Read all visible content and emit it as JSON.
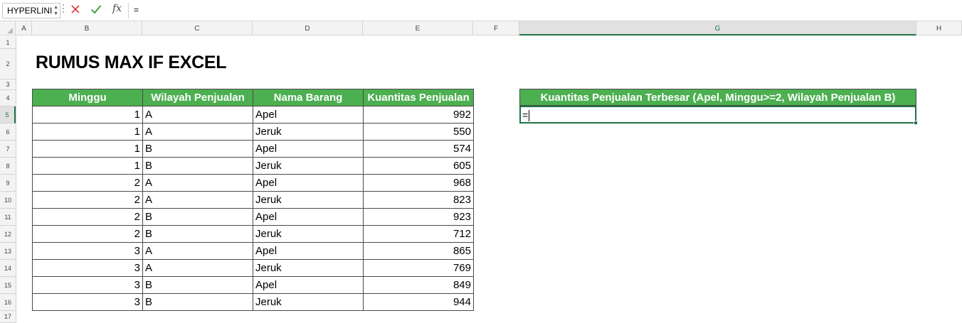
{
  "formula_bar": {
    "name_box": "HYPERLINI",
    "fx_label": "fx",
    "formula": "="
  },
  "columns": [
    "A",
    "B",
    "C",
    "D",
    "E",
    "F",
    "G",
    "H"
  ],
  "rows": [
    "1",
    "2",
    "3",
    "4",
    "5",
    "6",
    "7",
    "8",
    "9",
    "10",
    "11",
    "12",
    "13",
    "14",
    "15",
    "16",
    "17"
  ],
  "selected": {
    "column": "G",
    "row": "5"
  },
  "title": "RUMUS MAX IF EXCEL",
  "table": {
    "headers": [
      "Minggu",
      "Wilayah Penjualan",
      "Nama Barang",
      "Kuantitas Penjualan"
    ],
    "rows": [
      [
        "1",
        "A",
        "Apel",
        "992"
      ],
      [
        "1",
        "A",
        "Jeruk",
        "550"
      ],
      [
        "1",
        "B",
        "Apel",
        "574"
      ],
      [
        "1",
        "B",
        "Jeruk",
        "605"
      ],
      [
        "2",
        "A",
        "Apel",
        "968"
      ],
      [
        "2",
        "A",
        "Jeruk",
        "823"
      ],
      [
        "2",
        "B",
        "Apel",
        "923"
      ],
      [
        "2",
        "B",
        "Jeruk",
        "712"
      ],
      [
        "3",
        "A",
        "Apel",
        "865"
      ],
      [
        "3",
        "A",
        "Jeruk",
        "769"
      ],
      [
        "3",
        "B",
        "Apel",
        "849"
      ],
      [
        "3",
        "B",
        "Jeruk",
        "944"
      ]
    ]
  },
  "result": {
    "header": "Kuantitas Penjualan Terbesar (Apel, Minggu>=2, Wilayah Penjualan B)",
    "cell": "="
  },
  "colors": {
    "header_fill": "#4caf50",
    "selection": "#217346",
    "cancel_icon": "#e04040",
    "enter_icon": "#3a9a3a"
  },
  "icons": [
    "cancel-icon",
    "enter-icon",
    "fx-icon"
  ]
}
